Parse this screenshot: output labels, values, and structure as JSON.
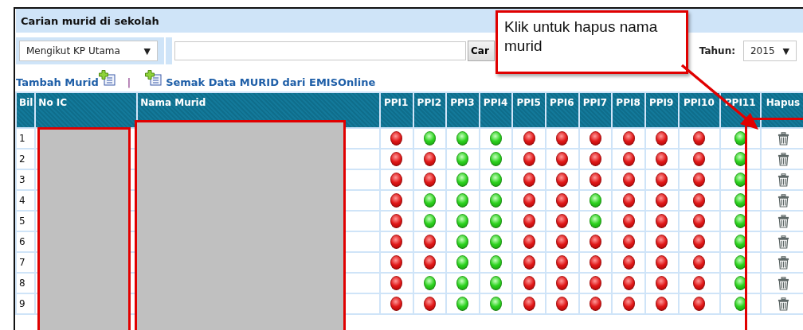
{
  "panel": {
    "title": "Carian murid di sekolah"
  },
  "search": {
    "filter": "Mengikut KP Utama",
    "filter_arrow": "▼",
    "button": "Car",
    "year_label": "Tahun:",
    "year": "2015",
    "year_arrow": "▼"
  },
  "links": [
    {
      "label": "Tambah Murid"
    },
    {
      "label": "Semak Data MURID dari EMISOnline"
    }
  ],
  "link_separator": "|",
  "table": {
    "columns": [
      "Bil",
      "No IC",
      "Nama Murid",
      "PPI1",
      "PPI2",
      "PPI3",
      "PPI4",
      "PPI5",
      "PPI6",
      "PPI7",
      "PPI8",
      "PPI9",
      "PPI10",
      "PPI11",
      "Hapus"
    ],
    "rows": [
      {
        "bil": "1",
        "ppi": [
          false,
          true,
          true,
          true,
          false,
          false,
          false,
          false,
          false,
          false,
          true
        ]
      },
      {
        "bil": "2",
        "ppi": [
          false,
          false,
          true,
          true,
          false,
          false,
          false,
          false,
          false,
          false,
          true
        ]
      },
      {
        "bil": "3",
        "ppi": [
          false,
          false,
          true,
          true,
          false,
          false,
          false,
          false,
          false,
          false,
          true
        ]
      },
      {
        "bil": "4",
        "ppi": [
          false,
          true,
          true,
          true,
          false,
          false,
          true,
          false,
          false,
          false,
          true
        ]
      },
      {
        "bil": "5",
        "ppi": [
          false,
          true,
          true,
          true,
          false,
          false,
          true,
          false,
          false,
          false,
          true
        ]
      },
      {
        "bil": "6",
        "ppi": [
          false,
          false,
          true,
          true,
          false,
          false,
          false,
          false,
          false,
          false,
          true
        ]
      },
      {
        "bil": "7",
        "ppi": [
          false,
          false,
          true,
          true,
          false,
          false,
          false,
          false,
          false,
          false,
          true
        ]
      },
      {
        "bil": "8",
        "ppi": [
          false,
          true,
          true,
          true,
          false,
          false,
          false,
          false,
          false,
          false,
          true
        ]
      },
      {
        "bil": "9",
        "ppi": [
          false,
          false,
          true,
          true,
          false,
          false,
          false,
          false,
          false,
          false,
          true
        ]
      }
    ]
  },
  "callout": {
    "text": "Klik untuk hapus nama murid"
  }
}
